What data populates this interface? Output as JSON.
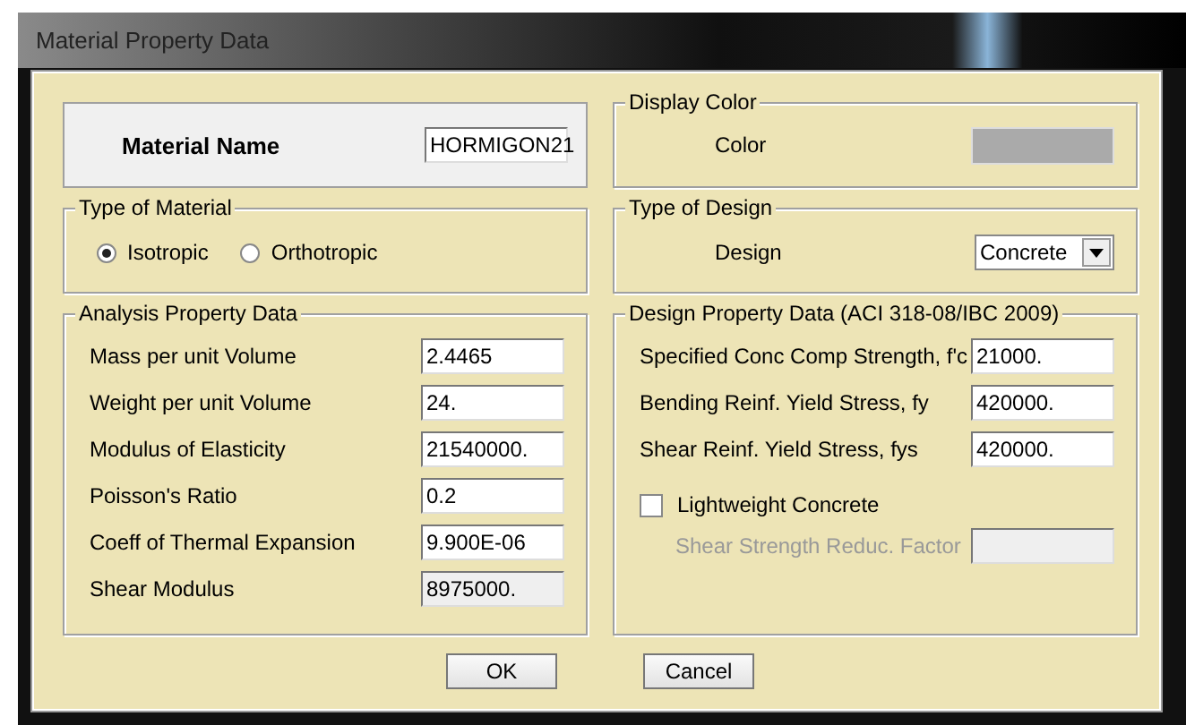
{
  "window": {
    "title": "Material Property Data"
  },
  "material_name": {
    "label": "Material Name",
    "value": "HORMIGON21"
  },
  "type_of_material": {
    "title": "Type of Material",
    "options": [
      {
        "label": "Isotropic",
        "selected": true
      },
      {
        "label": "Orthotropic",
        "selected": false
      }
    ]
  },
  "analysis_property_data": {
    "title": "Analysis Property Data",
    "fields": [
      {
        "label": "Mass per unit Volume",
        "value": "2.4465",
        "disabled": false
      },
      {
        "label": "Weight per unit Volume",
        "value": "24.",
        "disabled": false
      },
      {
        "label": "Modulus of Elasticity",
        "value": "21540000.",
        "disabled": false
      },
      {
        "label": "Poisson's Ratio",
        "value": "0.2",
        "disabled": false
      },
      {
        "label": "Coeff of Thermal Expansion",
        "value": "9.900E-06",
        "disabled": false
      },
      {
        "label": "Shear Modulus",
        "value": "8975000.",
        "disabled": true
      }
    ]
  },
  "display_color": {
    "title": "Display Color",
    "label": "Color",
    "color": "#aaaaaa"
  },
  "type_of_design": {
    "title": "Type of Design",
    "label": "Design",
    "value": "Concrete"
  },
  "design_property_data": {
    "title": "Design Property Data (ACI 318-08/IBC 2009)",
    "fields": [
      {
        "label": "Specified Conc Comp Strength, f'c",
        "value": "21000.",
        "disabled": false
      },
      {
        "label": "Bending Reinf. Yield Stress, fy",
        "value": "420000.",
        "disabled": false
      },
      {
        "label": "Shear Reinf. Yield Stress, fys",
        "value": "420000.",
        "disabled": false
      }
    ],
    "lightweight": {
      "label": "Lightweight Concrete",
      "checked": false
    },
    "reduction_factor": {
      "label": "Shear Strength Reduc. Factor",
      "disabled": true
    }
  },
  "buttons": [
    {
      "label": "OK"
    },
    {
      "label": "Cancel"
    }
  ]
}
